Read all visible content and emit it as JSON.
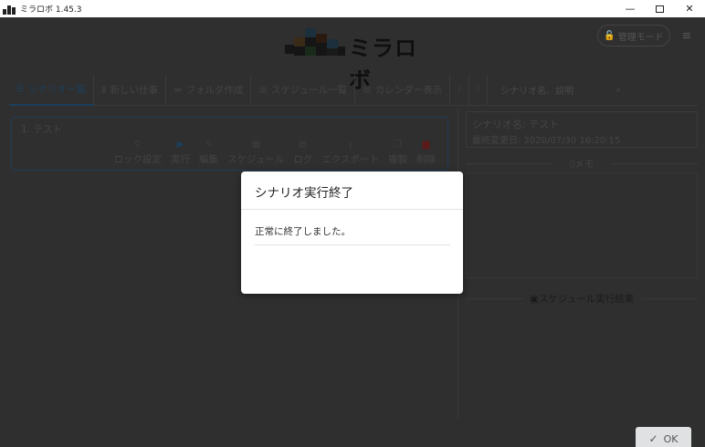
{
  "window": {
    "title": "ミラロボ 1.45.3",
    "minimize_glyph": "—",
    "close_glyph": "✕"
  },
  "header": {
    "logo_text": "ミラロボ",
    "admin_mode_label": "管理モード",
    "menu_glyph": "≡"
  },
  "toolbar": {
    "items": [
      {
        "label": "シナリオ一覧",
        "icon": "list-icon"
      },
      {
        "label": "新しい仕事",
        "icon": "file-icon"
      },
      {
        "label": "フォルダ作成",
        "icon": "folder-icon"
      },
      {
        "label": "スケジュール一覧",
        "icon": "calendar-icon"
      },
      {
        "label": "カレンダー表示",
        "icon": "calendar-icon"
      }
    ],
    "search_placeholder": "シナリオ名、説明"
  },
  "scenario": {
    "name": "1. テスト",
    "actions": [
      "ロック設定",
      "実行",
      "編集",
      "スケジュール",
      "ログ",
      "エクスポート",
      "複製",
      "削除"
    ]
  },
  "details": {
    "scenario_name": "シナリオ名: テスト",
    "last_modified": "最終変更日: 2020/07/30 16:20:15",
    "memo_heading": "メモ",
    "schedule_heading": "スケジュール実行結果"
  },
  "dialog": {
    "title": "シナリオ実行終了",
    "message": "正常に終了しました。",
    "ok_label": "OK"
  }
}
